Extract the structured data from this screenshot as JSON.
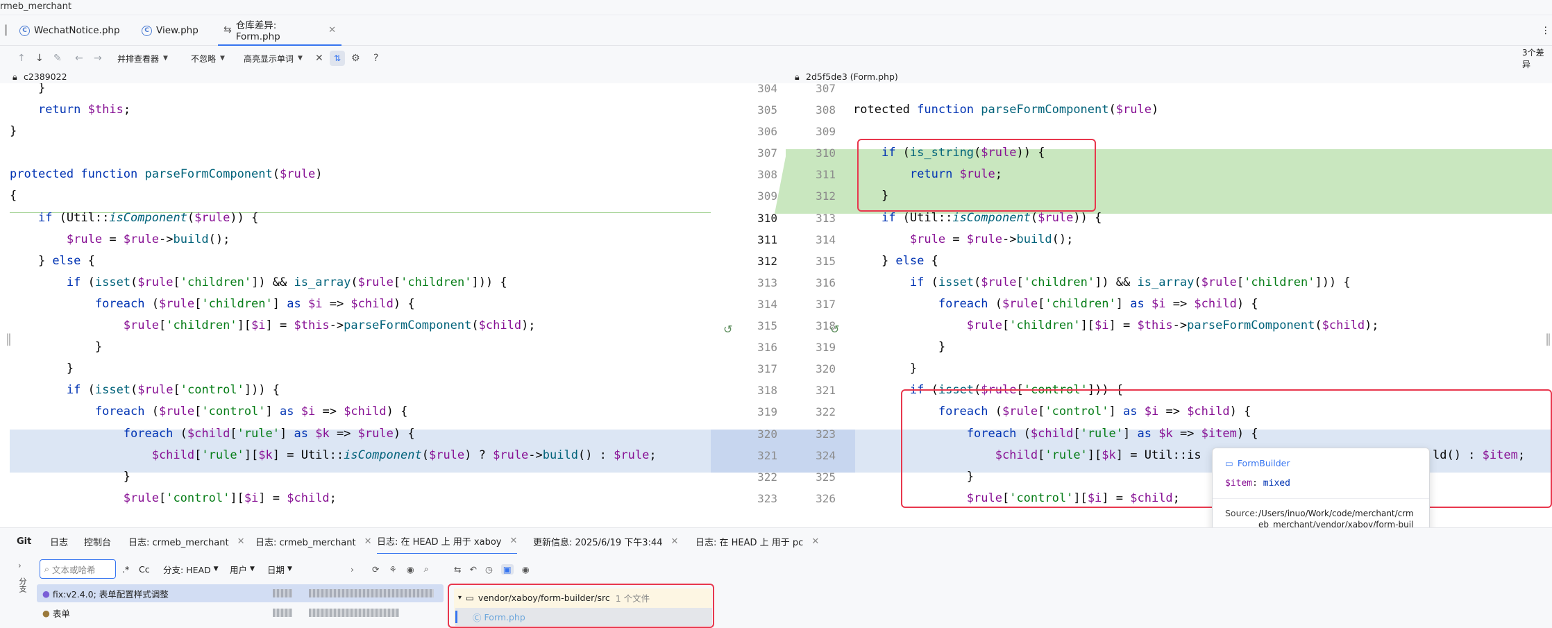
{
  "window": {
    "project": "rmeb_merchant"
  },
  "tabs": [
    {
      "label": "WechatNotice.php",
      "icon": "php-class-icon"
    },
    {
      "label": "View.php",
      "icon": "php-class-icon"
    },
    {
      "label": "仓库差异: Form.php",
      "icon": "diff-icon",
      "active": true
    }
  ],
  "toolbar": {
    "viewer": "并排查看器",
    "ignore": "不忽略",
    "highlight": "高亮显示单词",
    "diff_count": "3个差异"
  },
  "revisions": {
    "left": "c2389022",
    "right": "2d5f5de3 (Form.php)"
  },
  "diff": {
    "left_lines": [
      "    }",
      "    return $this;",
      "}",
      "",
      "protected function parseFormComponent($rule)",
      "{",
      "    if (Util::isComponent($rule)) {",
      "        $rule = $rule->build();",
      "    } else {",
      "        if (isset($rule['children']) && is_array($rule['children'])) {",
      "            foreach ($rule['children'] as $i => $child) {",
      "                $rule['children'][$i] = $this->parseFormComponent($child);",
      "            }",
      "        }",
      "        if (isset($rule['control'])) {",
      "            foreach ($rule['control'] as $i => $child) {",
      "                foreach ($child['rule'] as $k => $rule) {",
      "                    $child['rule'][$k] = Util::isComponent($rule) ? $rule->build() : $rule;",
      "                }",
      "                $rule['control'][$i] = $child;"
    ],
    "left_nums": [
      "304",
      "305",
      "306",
      "307",
      "308",
      "309",
      "310",
      "311",
      "312",
      "313",
      "314",
      "315",
      "316",
      "317",
      "318",
      "319",
      "320",
      "321",
      "322",
      "323"
    ],
    "right_nums": [
      "307",
      "308",
      "309",
      "310",
      "311",
      "312",
      "313",
      "314",
      "315",
      "316",
      "317",
      "318",
      "319",
      "320",
      "321",
      "322",
      "323",
      "324",
      "325",
      "326"
    ],
    "right_lines": [
      "",
      "rotected function parseFormComponent($rule)",
      "",
      "    if (is_string($rule)) {",
      "        return $rule;",
      "    }",
      "    if (Util::isComponent($rule)) {",
      "        $rule = $rule->build();",
      "    } else {",
      "        if (isset($rule['children']) && is_array($rule['children'])) {",
      "            foreach ($rule['children'] as $i => $child) {",
      "                $rule['children'][$i] = $this->parseFormComponent($child);",
      "            }",
      "        }",
      "        if (isset($rule['control'])) {",
      "            foreach ($rule['control'] as $i => $child) {",
      "                foreach ($child['rule'] as $k => $item) {",
      "                    $child['rule'][$k] = Util::is",
      "                }",
      "                $rule['control'][$i] = $child;"
    ],
    "right_tail_324": "ld() : $item;"
  },
  "popup": {
    "class": "FormBuilder",
    "signature_var": "$item",
    "signature_type": "mixed",
    "source_label": "Source:",
    "source_path": "/Users/inuo/Work/code/merchant/crmeb_merchant/vendor/xaboy/form-builder/src/Form.php"
  },
  "bottom_tabs": [
    {
      "label": "Git"
    },
    {
      "label": "日志"
    },
    {
      "label": "控制台"
    },
    {
      "label": "日志: crmeb_merchant"
    },
    {
      "label": "日志: crmeb_merchant"
    },
    {
      "label": "日志: 在 HEAD 上 用于 xaboy",
      "active": true
    },
    {
      "label": "更新信息: 2025/6/19 下午3:44"
    },
    {
      "label": "日志: 在 HEAD 上 用于 pc"
    }
  ],
  "log": {
    "search_placeholder": "文本或哈希",
    "regex": ".*",
    "case": "Cc",
    "branch_filter": "分支: HEAD",
    "user_filter": "用户",
    "date_filter": "日期",
    "side_label": "分支",
    "commits": [
      {
        "message": "fix:v2.4.0; 表单配置样式调整",
        "selected": true
      },
      {
        "message": "表单"
      }
    ],
    "changes_folder": "vendor/xaboy/form-builder/src",
    "changes_count": "1 个文件",
    "changes_file": "Form.php"
  }
}
